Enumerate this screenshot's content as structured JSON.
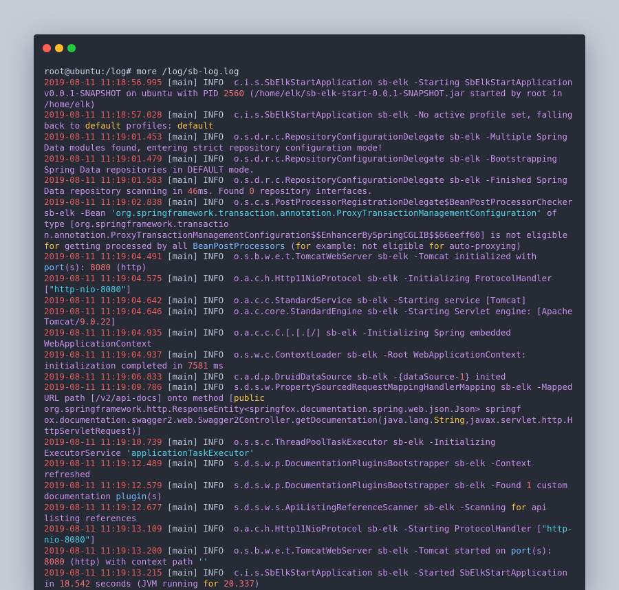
{
  "window": {
    "controls": [
      "close",
      "minimize",
      "maximize"
    ],
    "colors": {
      "close": "#ff5f56",
      "minimize": "#ffbd2e",
      "maximize": "#27c93f"
    }
  },
  "terminal": {
    "lines": [
      [
        {
          "t": "root@ubuntu:/log# more /log/sb-log.log",
          "c": "prompt"
        }
      ],
      [
        {
          "t": "2019-08-11 11:18:56.995",
          "c": "ts"
        },
        {
          "t": " [main] INFO  ",
          "c": "pl"
        },
        {
          "t": "c.i.s.SbElkStartApplication sb-elk -Starting SbElkStartApplication",
          "c": "vi"
        }
      ],
      [
        {
          "t": "v0.0.1-SNAPSHOT on ubuntu with PID ",
          "c": "vi"
        },
        {
          "t": "2560",
          "c": "num"
        },
        {
          "t": " (/home/elk/sb-elk-start-0.0.1-SNAPSHOT.jar started by root in",
          "c": "vi"
        }
      ],
      [
        {
          "t": "/home/elk)",
          "c": "vi"
        }
      ],
      [
        {
          "t": "2019-08-11 11:18:57.028",
          "c": "ts"
        },
        {
          "t": " [main] INFO  ",
          "c": "pl"
        },
        {
          "t": "c.i.s.SbElkStartApplication sb-elk -No active profile set, falling",
          "c": "vi"
        }
      ],
      [
        {
          "t": "back to ",
          "c": "vi"
        },
        {
          "t": "default",
          "c": "kw"
        },
        {
          "t": " profiles: ",
          "c": "vi"
        },
        {
          "t": "default",
          "c": "kw"
        }
      ],
      [
        {
          "t": "2019-08-11 11:19:01.453",
          "c": "ts"
        },
        {
          "t": " [main] INFO  ",
          "c": "pl"
        },
        {
          "t": "o.s.d.r.c.RepositoryConfigurationDelegate sb-elk -Multiple Spring",
          "c": "vi"
        }
      ],
      [
        {
          "t": "Data modules found, entering strict repository configuration mode!",
          "c": "vi"
        }
      ],
      [
        {
          "t": "2019-08-11 11:19:01.479",
          "c": "ts"
        },
        {
          "t": " [main] INFO  ",
          "c": "pl"
        },
        {
          "t": "o.s.d.r.c.RepositoryConfigurationDelegate sb-elk -Bootstrapping",
          "c": "vi"
        }
      ],
      [
        {
          "t": "Spring Data repositories in DEFAULT mode.",
          "c": "vi"
        }
      ],
      [
        {
          "t": "2019-08-11 11:19:01.583",
          "c": "ts"
        },
        {
          "t": " [main] INFO  ",
          "c": "pl"
        },
        {
          "t": "o.s.d.r.c.RepositoryConfigurationDelegate sb-elk -Finished Spring",
          "c": "vi"
        }
      ],
      [
        {
          "t": "Data repository scanning in ",
          "c": "vi"
        },
        {
          "t": "46",
          "c": "num"
        },
        {
          "t": "ms. Found ",
          "c": "vi"
        },
        {
          "t": "0",
          "c": "num"
        },
        {
          "t": " repository interfaces.",
          "c": "vi"
        }
      ],
      [
        {
          "t": "2019-08-11 11:19:02.838",
          "c": "ts"
        },
        {
          "t": " [main] INFO  ",
          "c": "pl"
        },
        {
          "t": "o.s.c.s.PostProcessorRegistrationDelegate$BeanPostProcessorChecker",
          "c": "vi"
        }
      ],
      [
        {
          "t": "sb-elk -Bean ",
          "c": "vi"
        },
        {
          "t": "'org.springframework.transaction.annotation.ProxyTransactionManagementConfiguration'",
          "c": "str"
        },
        {
          "t": " of",
          "c": "vi"
        }
      ],
      [
        {
          "t": "type [org.springframework.transactio",
          "c": "vi"
        }
      ],
      [
        {
          "t": "n.annotation.ProxyTransactionManagementConfiguration$$EnhancerBySpringCGLIB$$66eeff60] is not eligible",
          "c": "vi"
        }
      ],
      [
        {
          "t": "for",
          "c": "kw"
        },
        {
          "t": " getting processed by all ",
          "c": "vi"
        },
        {
          "t": "BeanPostProcessors",
          "c": "cls"
        },
        {
          "t": " (",
          "c": "vi"
        },
        {
          "t": "for",
          "c": "kw"
        },
        {
          "t": " example: not eligible ",
          "c": "vi"
        },
        {
          "t": "for",
          "c": "kw"
        },
        {
          "t": " auto-proxying)",
          "c": "vi"
        }
      ],
      [
        {
          "t": "2019-08-11 11:19:04.491",
          "c": "ts"
        },
        {
          "t": " [main] INFO  ",
          "c": "pl"
        },
        {
          "t": "o.s.b.w.e.t.TomcatWebServer sb-elk -Tomcat initialized with",
          "c": "vi"
        }
      ],
      [
        {
          "t": "port",
          "c": "cls"
        },
        {
          "t": "(s): ",
          "c": "vi"
        },
        {
          "t": "8080",
          "c": "num"
        },
        {
          "t": " (http)",
          "c": "vi"
        }
      ],
      [
        {
          "t": "2019-08-11 11:19:04.575",
          "c": "ts"
        },
        {
          "t": " [main] INFO  ",
          "c": "pl"
        },
        {
          "t": "o.a.c.h.Http11NioProtocol sb-elk -Initializing ProtocolHandler",
          "c": "vi"
        }
      ],
      [
        {
          "t": "[",
          "c": "vi"
        },
        {
          "t": "\"http-nio-8080\"",
          "c": "str"
        },
        {
          "t": "]",
          "c": "vi"
        }
      ],
      [
        {
          "t": "2019-08-11 11:19:04.642",
          "c": "ts"
        },
        {
          "t": " [main] INFO  ",
          "c": "pl"
        },
        {
          "t": "o.a.c.c.StandardService sb-elk -Starting service [Tomcat]",
          "c": "vi"
        }
      ],
      [
        {
          "t": "2019-08-11 11:19:04.646",
          "c": "ts"
        },
        {
          "t": " [main] INFO  ",
          "c": "pl"
        },
        {
          "t": "o.a.c.core.StandardEngine sb-elk -Starting Servlet engine: [Apache",
          "c": "vi"
        }
      ],
      [
        {
          "t": "Tomcat/",
          "c": "vi"
        },
        {
          "t": "9.0",
          "c": "num"
        },
        {
          "t": ".",
          "c": "vi"
        },
        {
          "t": "22",
          "c": "num"
        },
        {
          "t": "]",
          "c": "vi"
        }
      ],
      [
        {
          "t": "2019-08-11 11:19:04.935",
          "c": "ts"
        },
        {
          "t": " [main] INFO  ",
          "c": "pl"
        },
        {
          "t": "o.a.c.c.C.[.[.[/] sb-elk -Initializing Spring embedded",
          "c": "vi"
        }
      ],
      [
        {
          "t": "WebApplicationContext",
          "c": "vi"
        }
      ],
      [
        {
          "t": "2019-08-11 11:19:04.937",
          "c": "ts"
        },
        {
          "t": " [main] INFO  ",
          "c": "pl"
        },
        {
          "t": "o.s.w.c.ContextLoader sb-elk -Root WebApplicationContext:",
          "c": "vi"
        }
      ],
      [
        {
          "t": "initialization completed in ",
          "c": "vi"
        },
        {
          "t": "7581",
          "c": "num"
        },
        {
          "t": " ms",
          "c": "vi"
        }
      ],
      [
        {
          "t": "2019-08-11 11:19:06.833",
          "c": "ts"
        },
        {
          "t": " [main] INFO  ",
          "c": "pl"
        },
        {
          "t": "c.a.d.p.DruidDataSource sb-elk -{dataSource-",
          "c": "vi"
        },
        {
          "t": "1",
          "c": "num"
        },
        {
          "t": "} inited",
          "c": "vi"
        }
      ],
      [
        {
          "t": "2019-08-11 11:19:09.786",
          "c": "ts"
        },
        {
          "t": " [main] INFO  ",
          "c": "pl"
        },
        {
          "t": "s.d.s.w.PropertySourcedRequestMappingHandlerMapping sb-elk -Mapped",
          "c": "vi"
        }
      ],
      [
        {
          "t": "URL path [/v2/api-docs] onto method [",
          "c": "vi"
        },
        {
          "t": "public",
          "c": "kw"
        }
      ],
      [
        {
          "t": "org.springframework.http.ResponseEntity<springfox.documentation.spring.web.json.Json> springf",
          "c": "vi"
        }
      ],
      [
        {
          "t": "ox.documentation.swagger2.web.Swagger2Controller.getDocumentation(java.lang.",
          "c": "vi"
        },
        {
          "t": "String",
          "c": "kw"
        },
        {
          "t": ",javax.servlet.http.H",
          "c": "vi"
        }
      ],
      [
        {
          "t": "ttpServletRequest)]",
          "c": "vi"
        }
      ],
      [
        {
          "t": "2019-08-11 11:19:10.739",
          "c": "ts"
        },
        {
          "t": " [main] INFO  ",
          "c": "pl"
        },
        {
          "t": "o.s.s.c.ThreadPoolTaskExecutor sb-elk -Initializing",
          "c": "vi"
        }
      ],
      [
        {
          "t": "ExecutorService ",
          "c": "vi"
        },
        {
          "t": "'applicationTaskExecutor'",
          "c": "str"
        }
      ],
      [
        {
          "t": "2019-08-11 11:19:12.489",
          "c": "ts"
        },
        {
          "t": " [main] INFO  ",
          "c": "pl"
        },
        {
          "t": "s.d.s.w.p.DocumentationPluginsBootstrapper sb-elk -Context",
          "c": "vi"
        }
      ],
      [
        {
          "t": "refreshed",
          "c": "vi"
        }
      ],
      [
        {
          "t": "2019-08-11 11:19:12.579",
          "c": "ts"
        },
        {
          "t": " [main] INFO  ",
          "c": "pl"
        },
        {
          "t": "s.d.s.w.p.DocumentationPluginsBootstrapper sb-elk -Found ",
          "c": "vi"
        },
        {
          "t": "1",
          "c": "num"
        },
        {
          "t": " custom",
          "c": "vi"
        }
      ],
      [
        {
          "t": "documentation ",
          "c": "vi"
        },
        {
          "t": "plugin",
          "c": "cls"
        },
        {
          "t": "(s)",
          "c": "vi"
        }
      ],
      [
        {
          "t": "2019-08-11 11:19:12.677",
          "c": "ts"
        },
        {
          "t": " [main] INFO  ",
          "c": "pl"
        },
        {
          "t": "s.d.s.w.s.ApiListingReferenceScanner sb-elk -Scanning ",
          "c": "vi"
        },
        {
          "t": "for",
          "c": "kw"
        },
        {
          "t": " api",
          "c": "vi"
        }
      ],
      [
        {
          "t": "listing references",
          "c": "vi"
        }
      ],
      [
        {
          "t": "2019-08-11 11:19:13.109",
          "c": "ts"
        },
        {
          "t": " [main] INFO  ",
          "c": "pl"
        },
        {
          "t": "o.a.c.h.Http11NioProtocol sb-elk -Starting ProtocolHandler [",
          "c": "vi"
        },
        {
          "t": "\"http-",
          "c": "str"
        }
      ],
      [
        {
          "t": "nio-8080\"",
          "c": "str"
        },
        {
          "t": "]",
          "c": "vi"
        }
      ],
      [
        {
          "t": "2019-08-11 11:19:13.200",
          "c": "ts"
        },
        {
          "t": " [main] INFO  ",
          "c": "pl"
        },
        {
          "t": "o.s.b.w.e.t.TomcatWebServer sb-elk -Tomcat started on ",
          "c": "vi"
        },
        {
          "t": "port",
          "c": "cls"
        },
        {
          "t": "(s):",
          "c": "vi"
        }
      ],
      [
        {
          "t": "8080",
          "c": "num"
        },
        {
          "t": " (http) with context path ",
          "c": "vi"
        },
        {
          "t": "''",
          "c": "str"
        }
      ],
      [
        {
          "t": "2019-08-11 11:19:13.215",
          "c": "ts"
        },
        {
          "t": " [main] INFO  ",
          "c": "pl"
        },
        {
          "t": "c.i.s.SbElkStartApplication sb-elk -Started SbElkStartApplication",
          "c": "vi"
        }
      ],
      [
        {
          "t": "in ",
          "c": "vi"
        },
        {
          "t": "18.542",
          "c": "num"
        },
        {
          "t": " seconds (JVM running ",
          "c": "vi"
        },
        {
          "t": "for",
          "c": "kw"
        },
        {
          "t": " ",
          "c": "vi"
        },
        {
          "t": "20.337",
          "c": "num"
        },
        {
          "t": ")",
          "c": "vi"
        }
      ]
    ]
  }
}
